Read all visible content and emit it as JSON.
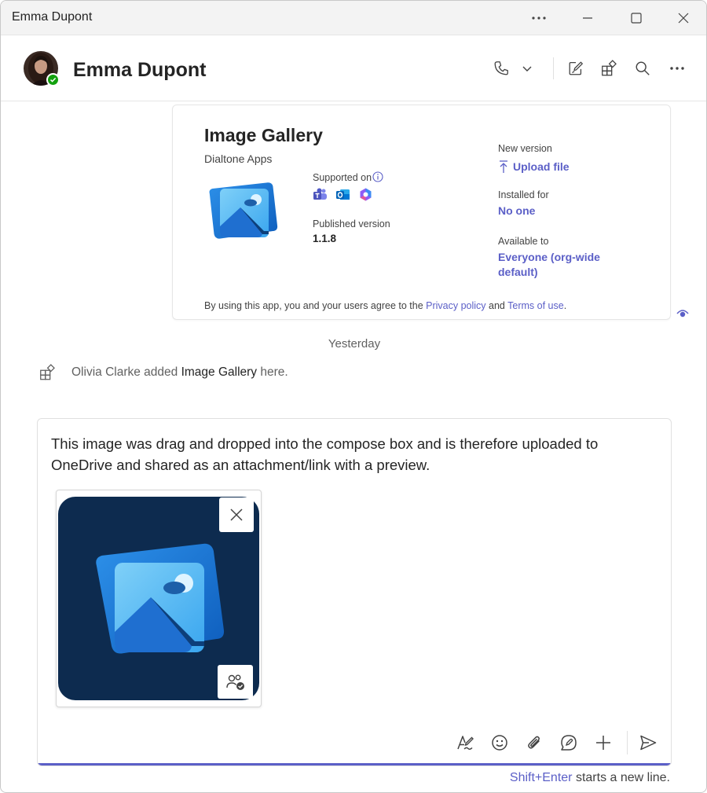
{
  "window": {
    "title": "Emma Dupont"
  },
  "header": {
    "name": "Emma Dupont"
  },
  "card": {
    "title": "Image Gallery",
    "publisher": "Dialtone Apps",
    "supported_on_label": "Supported on",
    "published_version_label": "Published version",
    "published_version": "1.1.8",
    "new_version_label": "New version",
    "upload_file": "Upload file",
    "installed_for_label": "Installed for",
    "installed_for": "No one",
    "available_to_label": "Available to",
    "available_to_line1": "Everyone (org-wide",
    "available_to_line2": "default)",
    "terms_prefix": "By using this app, you and your users agree to the ",
    "privacy_policy": "Privacy policy",
    "terms_and": " and ",
    "terms_of_use": "Terms of use",
    "terms_suffix": "."
  },
  "date_divider": "Yesterday",
  "system_message": {
    "actor": "Olivia Clarke",
    "action": " added ",
    "app": "Image Gallery",
    "suffix": " here."
  },
  "compose": {
    "message": "This image was drag and dropped into the compose box and is therefore uploaded to OneDrive and shared as an attachment/link with a preview."
  },
  "hint": {
    "key": "Shift+Enter",
    "text": " starts a new line."
  },
  "colors": {
    "accent": "#5b5fc7",
    "presence": "#13a10e",
    "thumb_bg": "#0d2b4f"
  }
}
